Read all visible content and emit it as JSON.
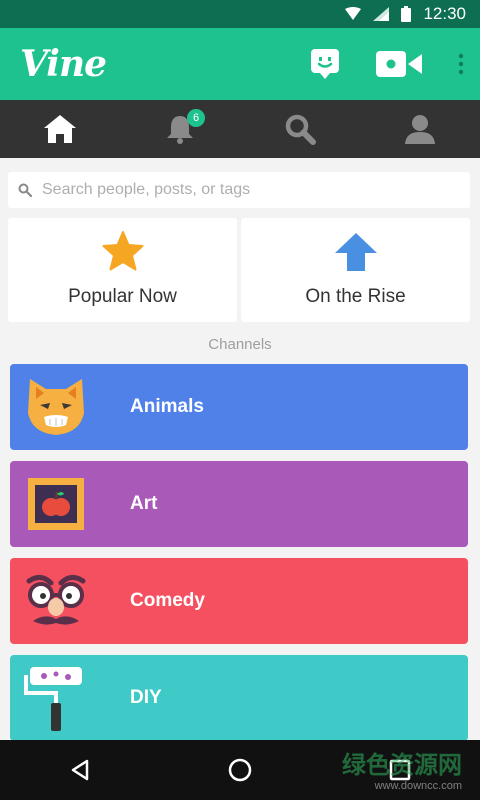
{
  "status_bar": {
    "time": "12:30",
    "icons": [
      "wifi-icon",
      "signal-icon",
      "battery-icon"
    ]
  },
  "app_bar": {
    "logo": "Vine",
    "actions": [
      "messages-icon",
      "video-camera-icon",
      "overflow-menu-icon"
    ]
  },
  "nav": {
    "tabs": [
      {
        "name": "home",
        "icon": "home-icon",
        "active": true
      },
      {
        "name": "notifications",
        "icon": "bell-icon",
        "badge": "6"
      },
      {
        "name": "search",
        "icon": "search-icon"
      },
      {
        "name": "profile",
        "icon": "profile-icon"
      }
    ]
  },
  "search": {
    "placeholder": "Search people, posts, or tags"
  },
  "featured": [
    {
      "label": "Popular Now",
      "icon": "star-icon",
      "color": "#f5a623"
    },
    {
      "label": "On the Rise",
      "icon": "up-arrow-icon",
      "color": "#4a90e2"
    }
  ],
  "channels_title": "Channels",
  "channels": [
    {
      "label": "Animals",
      "color": "#4f81e8",
      "icon": "cat-icon"
    },
    {
      "label": "Art",
      "color": "#a95ab8",
      "icon": "framed-apple-icon"
    },
    {
      "label": "Comedy",
      "color": "#f4505f",
      "icon": "disguise-glasses-icon"
    },
    {
      "label": "DIY",
      "color": "#3fc9c7",
      "icon": "paint-roller-icon"
    }
  ],
  "system_nav": [
    "back-icon",
    "home-circle-icon",
    "recents-icon"
  ],
  "watermark": {
    "title": "绿色资源网",
    "url": "www.downcc.com"
  }
}
